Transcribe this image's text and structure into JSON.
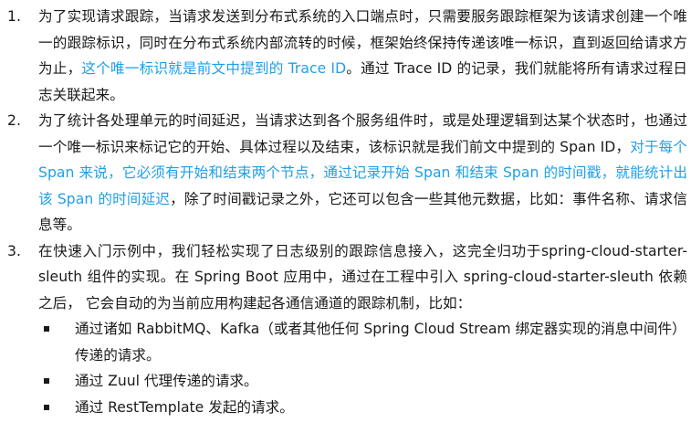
{
  "items": [
    {
      "number": "1.",
      "text_a": "为了实现请求跟踪，当请求发送到分布式系统的入口端点时，只需要服务跟踪框架为该请求创建一个唯一的跟踪标识，同时在分布式系统内部流转的时候，框架始终保持传递该唯一标识，直到返回给请求方为止，",
      "highlight": "这个唯一标识就是前文中提到的 Trace ID",
      "text_b": "。通过 Trace ID 的记录，我们就能将所有请求过程日志关联起来。"
    },
    {
      "number": "2.",
      "text_a": "为了统计各处理单元的时间延迟，当请求达到各个服务组件时，或是处理逻辑到达某个状态时，也通过一个唯一标识来标记它的开始、具体过程以及结束，该标识就是我们前文中提到的 Span ID，",
      "highlight": "对于每个 Span 来说，它必须有开始和结束两个节点，通过记录开始 Span 和结束 Span 的时间戳，就能统计出该 Span 的时间延迟",
      "text_b": "，除了时间戳记录之外，它还可以包含一些其他元数据，比如：事件名称、请求信息等。"
    },
    {
      "number": "3.",
      "text_a": "在快速入门示例中，我们轻松实现了日志级别的跟踪信息接入，这完全归功于spring-cloud-starter-sleuth 组件的实现。在 Spring Boot 应用中，通过在工程中引入 spring-cloud-starter-sleuth 依赖之后， 它会自动的为当前应用构建起各通信通道的跟踪机制，比如：",
      "highlight": "",
      "text_b": ""
    }
  ],
  "bullets": [
    "通过诸如 RabbitMQ、Kafka（或者其他任何 Spring Cloud Stream 绑定器实现的消息中间件）传递的请求。",
    "通过 Zuul 代理传递的请求。",
    "通过 RestTemplate 发起的请求。"
  ],
  "colors": {
    "text": "#1a1a1a",
    "highlight": "#1e9fe8"
  }
}
